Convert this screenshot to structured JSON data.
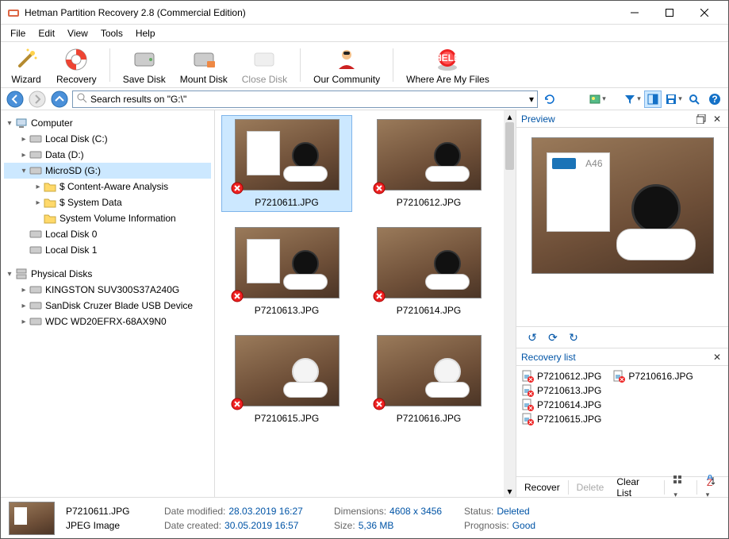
{
  "window": {
    "title": "Hetman Partition Recovery 2.8 (Commercial Edition)"
  },
  "menu": [
    "File",
    "Edit",
    "View",
    "Tools",
    "Help"
  ],
  "toolbar": {
    "wizard": "Wizard",
    "recovery": "Recovery",
    "save_disk": "Save Disk",
    "mount_disk": "Mount Disk",
    "close_disk": "Close Disk",
    "community": "Our Community",
    "where": "Where Are My Files"
  },
  "navbar": {
    "search_value": "Search results on \"G:\\\""
  },
  "tree": {
    "computer": "Computer",
    "local_c": "Local Disk (C:)",
    "data_d": "Data (D:)",
    "microsd": "MicroSD (G:)",
    "content_aware": "$ Content-Aware Analysis",
    "system_data": "$ System Data",
    "svi": "System Volume Information",
    "local0": "Local Disk 0",
    "local1": "Local Disk 1",
    "physical": "Physical Disks",
    "kingston": "KINGSTON SUV300S37A240G",
    "sandisk": "SanDisk Cruzer Blade USB Device",
    "wdc": "WDC WD20EFRX-68AX9N0"
  },
  "files": [
    {
      "name": "P7210611.JPG",
      "selected": true,
      "style": "box",
      "deleted": true
    },
    {
      "name": "P7210612.JPG",
      "selected": false,
      "style": "dark",
      "deleted": true
    },
    {
      "name": "P7210613.JPG",
      "selected": false,
      "style": "box",
      "deleted": true
    },
    {
      "name": "P7210614.JPG",
      "selected": false,
      "style": "dark",
      "deleted": true
    },
    {
      "name": "P7210615.JPG",
      "selected": false,
      "style": "white",
      "deleted": true
    },
    {
      "name": "P7210616.JPG",
      "selected": false,
      "style": "white",
      "deleted": true
    }
  ],
  "preview": {
    "title": "Preview",
    "model": "A46"
  },
  "recovery": {
    "title": "Recovery list",
    "items_col1": [
      "P7210612.JPG",
      "P7210613.JPG",
      "P7210614.JPG",
      "P7210615.JPG"
    ],
    "items_col2": [
      "P7210616.JPG"
    ],
    "recover": "Recover",
    "delete": "Delete",
    "clear": "Clear List"
  },
  "status": {
    "name": "P7210611.JPG",
    "type": "JPEG Image",
    "date_modified_label": "Date modified:",
    "date_modified": "28.03.2019 16:27",
    "date_created_label": "Date created:",
    "date_created": "30.05.2019 16:57",
    "dimensions_label": "Dimensions:",
    "dimensions": "4608 x 3456",
    "size_label": "Size:",
    "size": "5,36 MB",
    "status_label": "Status:",
    "status": "Deleted",
    "prognosis_label": "Prognosis:",
    "prognosis": "Good"
  }
}
